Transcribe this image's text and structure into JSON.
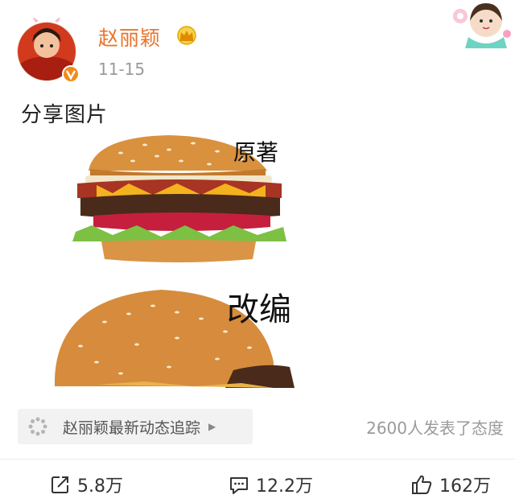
{
  "post": {
    "author": "赵丽颖",
    "date": "11-15",
    "text": "分享图片"
  },
  "meme": {
    "label_top": "原著",
    "label_bottom": "改编"
  },
  "topic": {
    "label": "赵丽颖最新动态追踪"
  },
  "reactions": {
    "summary": "2600人发表了态度"
  },
  "actions": {
    "share_count": "5.8万",
    "comment_count": "12.2万",
    "like_count": "162万"
  },
  "colors": {
    "author_name": "#e8742a",
    "muted_text": "#9a9a9a",
    "crown": "#f0b400"
  }
}
